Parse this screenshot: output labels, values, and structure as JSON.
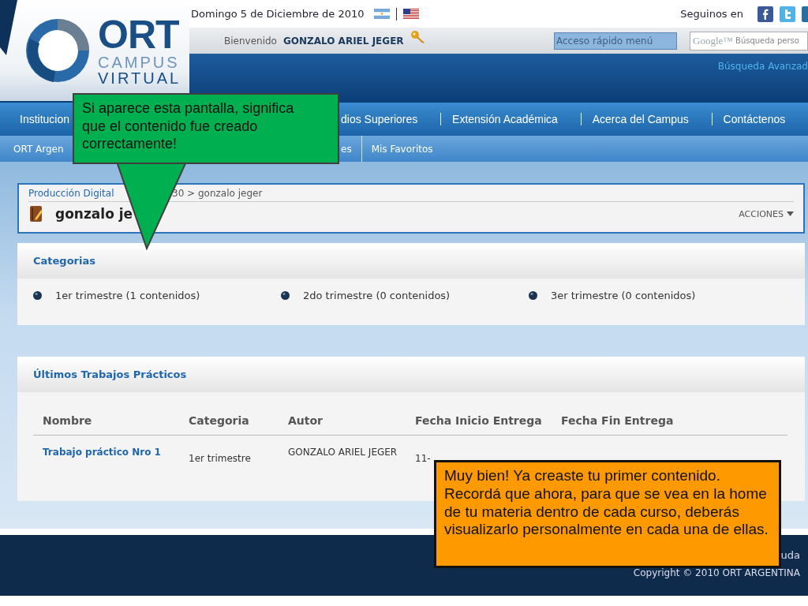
{
  "header": {
    "date": "Domingo 5 de Diciembre de 2010",
    "follow": "Seguinos en",
    "logo": {
      "name": "ORT",
      "line2": "CAMPUS",
      "line3": "VIRTUAL"
    },
    "welcome": "Bienvenido",
    "user": "GONZALO ARIEL JEGER",
    "quick_access": {
      "placeholder": "Acceso rápido menú"
    },
    "search": {
      "brand": "Google™",
      "placeholder": "Búsqueda perso"
    },
    "advanced_search": "Búsqueda Avanzad"
  },
  "nav": [
    "Institucion",
    "dios Superiores",
    "Extensión Académica",
    "Acerca del Campus",
    "Contáctenos"
  ],
  "subnav": [
    "ORT Argen",
    "es",
    "Mis Favoritos"
  ],
  "breadcrumb": [
    "Producción Digital",
    "30 > gonzalo jeger"
  ],
  "page_title": "gonzalo je",
  "actions": "ACCIONES",
  "categories": {
    "title": "Categorias",
    "items": [
      "1er trimestre (1 contenidos)",
      "2do trimestre (0 contenidos)",
      "3er trimestre (0 contenidos)"
    ]
  },
  "assignments": {
    "title": "Últimos Trabajos Prácticos",
    "columns": [
      "Nombre",
      "Categoria",
      "Autor",
      "Fecha Inicio Entrega",
      "Fecha Fin Entrega"
    ],
    "rows": [
      {
        "cells": [
          "Trabajo práctico Nro 1",
          "1er trimestre",
          "GONZALO ARIEL JEGER",
          "11-"
        ]
      }
    ]
  },
  "footer": {
    "link": "uda",
    "copyright": "Copyright © 2010 ORT ARGENTINA"
  },
  "callouts": [
    {
      "kind": "arrow",
      "color": "#00b050",
      "text": "Si aparece esta pantalla, significa que el contenido fue creado correctamente!"
    },
    {
      "kind": "box",
      "color": "#ff9900",
      "text": "Muy bien! Ya creaste tu primer contenido. Recordá que ahora, para que se vea en la home de tu materia dentro de cada curso, deberás visualizarlo personalmente en cada una de ellas."
    }
  ]
}
